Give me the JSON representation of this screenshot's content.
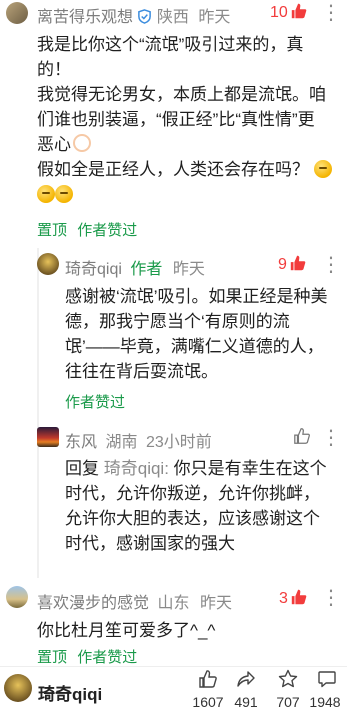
{
  "comments": [
    {
      "name": "离苦得乐观想",
      "location": "陕西",
      "time": "昨天",
      "likes": "10",
      "text_lines": [
        "我是比你这个“流氓”吸引过来的，真",
        "的！",
        "我觉得无论男女，本质上都是流氓。咱",
        "们谁也别装逼，“假正经”比“真性情”更",
        "恶心",
        "假如全是正经人，人类还会存在吗？"
      ],
      "pin_label": "置顶",
      "author_liked": "作者赞过"
    },
    {
      "name": "琦奇qiqi",
      "author_tag": "作者",
      "time": "昨天",
      "likes": "9",
      "text_lines": [
        "感谢被‘流氓’吸引。如果正经是种美",
        "德，那我宁愿当个‘有原则的流",
        "氓’——毕竟，满嘴仁义道德的人，",
        "往往在背后耍流氓。"
      ],
      "author_liked": "作者赞过"
    },
    {
      "name": "东风",
      "location": "湖南",
      "time": "23小时前",
      "reply_prefix": "回复",
      "reply_to": "琦奇qiqi:",
      "text_first": " 你只是有幸生在这个",
      "text_lines": [
        "时代，允许你叛逆，允许你挑衅，",
        "允许你大胆的表达，应该感谢这个",
        "时代，感谢国家的强大"
      ]
    },
    {
      "name": "喜欢漫步的感觉",
      "location": "山东",
      "time": "昨天",
      "likes": "3",
      "text_lines": [
        "你比杜月笙可爱多了^_^"
      ],
      "pin_label": "置顶",
      "author_liked": "作者赞过"
    }
  ],
  "footer": {
    "user_name": "琦奇qiqi",
    "like_count": "1607",
    "share_count": "491",
    "star_count": "707",
    "comment_count": "1948"
  },
  "colors": {
    "accent_green": "#1a9a4a",
    "like_red": "#f23c3c"
  },
  "icons": [
    "verified-badge-icon",
    "like-thumb-icon",
    "more-dots-icon",
    "share-icon",
    "star-icon",
    "comment-icon"
  ]
}
